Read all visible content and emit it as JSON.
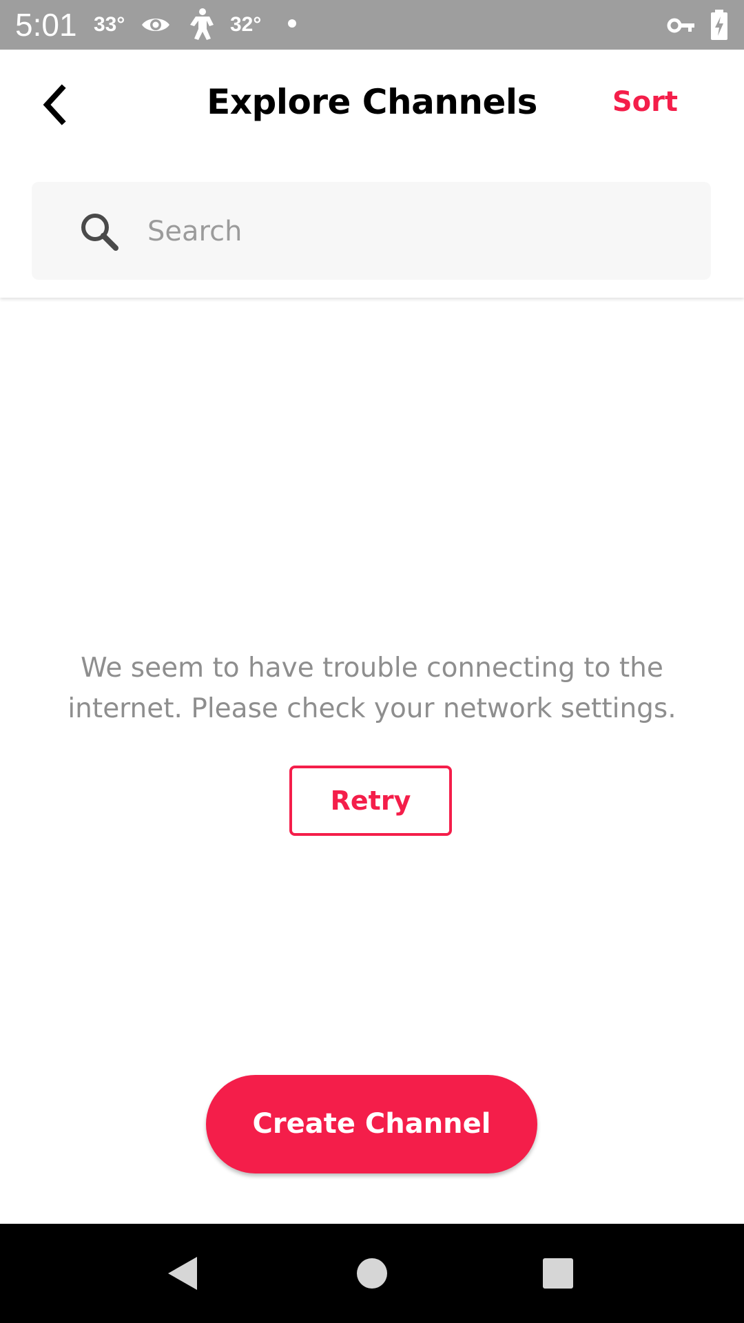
{
  "status_bar": {
    "time": "5:01",
    "temp_1": "33°",
    "temp_2": "32°",
    "icons": [
      "eye-icon",
      "figure-icon",
      "dot-icon",
      "vpn-key-icon",
      "battery-charging-icon"
    ]
  },
  "header": {
    "title": "Explore Channels",
    "sort_label": "Sort",
    "back_icon": "chevron-left-icon"
  },
  "search": {
    "placeholder": "Search",
    "value": "",
    "icon": "search-icon"
  },
  "main": {
    "error_message": "We seem to have trouble connecting to the internet. Please check your network settings.",
    "retry_label": "Retry",
    "create_label": "Create Channel"
  },
  "nav_bar": {
    "buttons": [
      "back-triangle-icon",
      "home-circle-icon",
      "recents-square-icon"
    ]
  },
  "colors": {
    "accent": "#f41e4a",
    "status_bar": "#9e9e9e",
    "nav_bar": "#000000",
    "search_bg": "#f7f7f7",
    "muted_text": "#8e8e8e"
  }
}
